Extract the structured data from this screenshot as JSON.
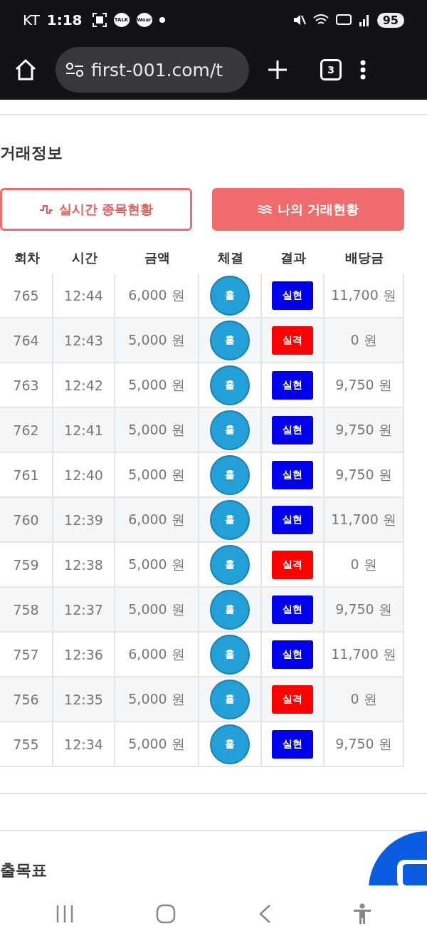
{
  "status_bar": {
    "carrier": "KT",
    "time": "1:18",
    "talk_badge": "TALK",
    "wear_badge": "Wear",
    "battery": "95"
  },
  "browser": {
    "url": "first-001.com/t",
    "tab_count": "3"
  },
  "section_title": "거래정보",
  "tabs": [
    {
      "label": "실시간 종목현황",
      "selected": false
    },
    {
      "label": "나의 거래현황",
      "selected": true
    }
  ],
  "table": {
    "columns": [
      "회차",
      "시간",
      "금액",
      "체결",
      "결과",
      "배당금"
    ],
    "rows": [
      {
        "round": "765",
        "time": "12:44",
        "amount": "6,000 원",
        "fill": "홀",
        "result": {
          "text": "실현",
          "kind": "hit"
        },
        "payout": "11,700 원"
      },
      {
        "round": "764",
        "time": "12:43",
        "amount": "5,000 원",
        "fill": "홀",
        "result": {
          "text": "실격",
          "kind": "miss"
        },
        "payout": "0 원"
      },
      {
        "round": "763",
        "time": "12:42",
        "amount": "5,000 원",
        "fill": "홀",
        "result": {
          "text": "실현",
          "kind": "hit"
        },
        "payout": "9,750 원"
      },
      {
        "round": "762",
        "time": "12:41",
        "amount": "5,000 원",
        "fill": "홀",
        "result": {
          "text": "실현",
          "kind": "hit"
        },
        "payout": "9,750 원"
      },
      {
        "round": "761",
        "time": "12:40",
        "amount": "5,000 원",
        "fill": "홀",
        "result": {
          "text": "실현",
          "kind": "hit"
        },
        "payout": "9,750 원"
      },
      {
        "round": "760",
        "time": "12:39",
        "amount": "6,000 원",
        "fill": "홀",
        "result": {
          "text": "실현",
          "kind": "hit"
        },
        "payout": "11,700 원"
      },
      {
        "round": "759",
        "time": "12:38",
        "amount": "5,000 원",
        "fill": "홀",
        "result": {
          "text": "실격",
          "kind": "miss"
        },
        "payout": "0 원"
      },
      {
        "round": "758",
        "time": "12:37",
        "amount": "5,000 원",
        "fill": "홀",
        "result": {
          "text": "실현",
          "kind": "hit"
        },
        "payout": "9,750 원"
      },
      {
        "round": "757",
        "time": "12:36",
        "amount": "6,000 원",
        "fill": "홀",
        "result": {
          "text": "실현",
          "kind": "hit"
        },
        "payout": "11,700 원"
      },
      {
        "round": "756",
        "time": "12:35",
        "amount": "5,000 원",
        "fill": "홀",
        "result": {
          "text": "실격",
          "kind": "miss"
        },
        "payout": "0 원"
      },
      {
        "round": "755",
        "time": "12:34",
        "amount": "5,000 원",
        "fill": "홀",
        "result": {
          "text": "실현",
          "kind": "hit"
        },
        "payout": "9,750 원"
      }
    ]
  },
  "next_section_title": "출목표"
}
